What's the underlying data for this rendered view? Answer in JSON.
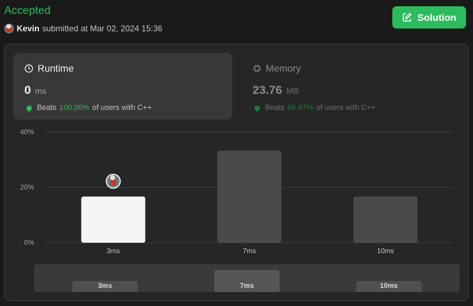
{
  "header": {
    "status": "Accepted",
    "username": "Kevin",
    "submitted_text": "submitted at Mar 02, 2024 15:36"
  },
  "solution_button": {
    "label": "Solution"
  },
  "runtime": {
    "title": "Runtime",
    "value": "0",
    "unit": "ms",
    "beats_label": "Beats",
    "beats_pct": "100.00%",
    "beats_suffix": "of users with C++"
  },
  "memory": {
    "title": "Memory",
    "value": "23.76",
    "unit": "MB",
    "beats_label": "Beats",
    "beats_pct": "66.67%",
    "beats_suffix": "of users with C++"
  },
  "colors": {
    "accent": "#2cbb5d",
    "selected_bar": "#f5f5f5",
    "bar": "#4a4a4a"
  },
  "chart_data": {
    "type": "bar",
    "categories": [
      "3ms",
      "7ms",
      "10ms"
    ],
    "values": [
      16.7,
      33.3,
      16.7
    ],
    "ylim": [
      0,
      40
    ],
    "yticks": [
      "0%",
      "20%",
      "40%"
    ],
    "highlight_index": 0
  },
  "distribution_nav": {
    "labels": [
      "3ms",
      "7ms",
      "10ms"
    ]
  }
}
